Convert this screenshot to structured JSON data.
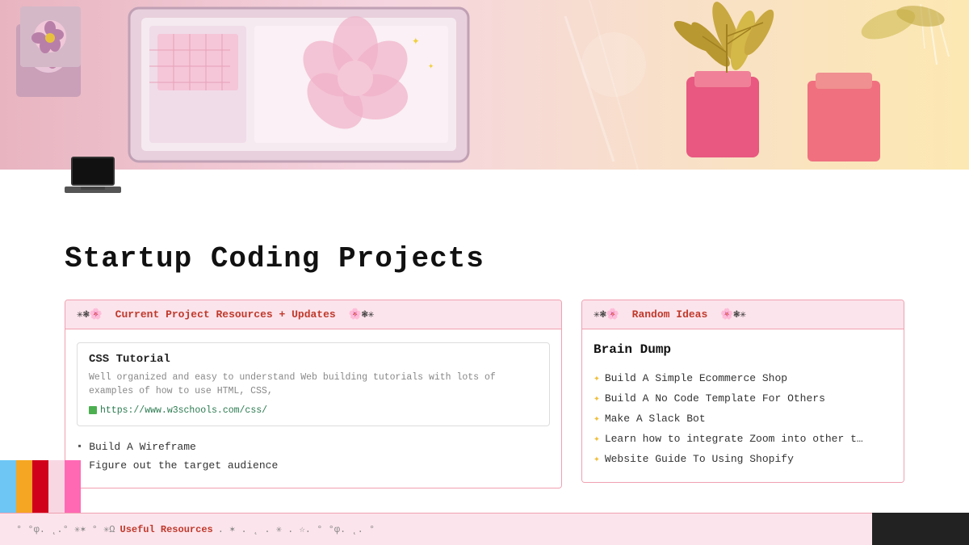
{
  "hero": {
    "alt": "Decorative coding workspace illustration"
  },
  "laptop_icon": "💻",
  "page_title": "Startup Coding Projects",
  "left_section": {
    "header": {
      "deco_left": "✳❃🌸",
      "title": "Current Project Resources + Updates",
      "deco_right": "🌸❃✳"
    },
    "resource_card": {
      "title": "CSS Tutorial",
      "description": "Well organized and easy to understand Web building\ntutorials with lots of examples of how to use HTML, CSS,",
      "link": "https://www.w3schools.com/css/"
    },
    "bullets": [
      "Build A Wireframe",
      "Figure out the target audience"
    ]
  },
  "right_section": {
    "header": {
      "deco_left": "✳❃🌸",
      "title": "Random Ideas",
      "deco_right": "🌸❃✳"
    },
    "brain_dump_title": "Brain Dump",
    "ideas": [
      "Build A Simple Ecommerce Shop",
      "Build A No Code Template For Others",
      "Make A Slack Bot",
      "Learn how to integrate Zoom into other t…",
      "Website Guide To Using Shopify"
    ]
  },
  "bottom_bar": {
    "text_left": "° °φ. ˛.° ✳✶ ° ✳Ω",
    "title": "Useful Resources",
    "text_right": ". ✶ . ˛ . ✳ . ☆. ° °φ. ˛. °"
  },
  "bottom_strips": [
    {
      "color": "#6ec6f5"
    },
    {
      "color": "#f5a623"
    },
    {
      "color": "#d0021b"
    },
    {
      "color": "#f8d7e3"
    },
    {
      "color": "#ff69b4"
    }
  ]
}
